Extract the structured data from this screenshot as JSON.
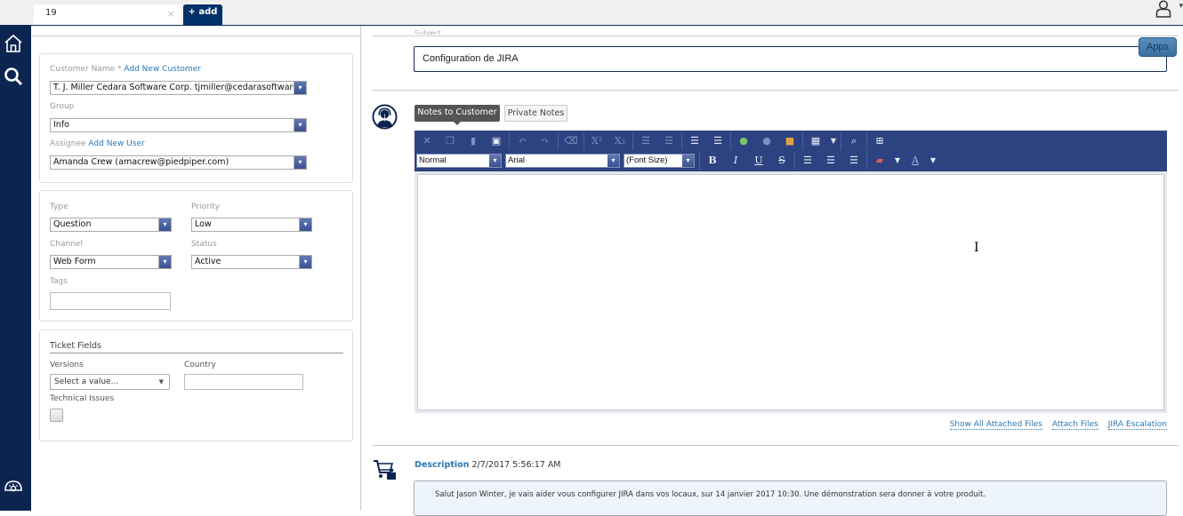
{
  "tabs": {
    "active_tab_label": "19",
    "close_symbol": "×",
    "add_label": "+ add"
  },
  "header": {
    "user_caret": "▾"
  },
  "sidebar": {
    "items": [
      {
        "name": "home",
        "icon": "home-icon"
      },
      {
        "name": "search",
        "icon": "search-icon"
      },
      {
        "name": "support",
        "icon": "support-icon"
      }
    ]
  },
  "customer_card": {
    "customer_label": "Customer Name",
    "required_mark": "*",
    "add_customer_link": "Add New Customer",
    "customer_value": "T. J. Miller Cedara Software Corp. tjmiller@cedarasoftware.com",
    "group_label": "Group",
    "group_value": "Info",
    "assignee_label": "Assignee",
    "add_user_link": "Add New User",
    "assignee_value": "Amanda Crew (amacrew@piedpiper.com)"
  },
  "properties_card": {
    "type_label": "Type",
    "type_value": "Question",
    "priority_label": "Priority",
    "priority_value": "Low",
    "channel_label": "Channel",
    "channel_value": "Web Form",
    "status_label": "Status",
    "status_value": "Active",
    "tags_label": "Tags",
    "tags_value": ""
  },
  "ticket_fields": {
    "title": "Ticket Fields",
    "versions_label": "Versions",
    "versions_placeholder": "Select a value...",
    "country_label": "Country",
    "country_value": "",
    "technical_issues_label": "Technical Issues",
    "technical_issues_checked": false
  },
  "subject": {
    "label": "Subject",
    "value": "Configuration de JIRA"
  },
  "apps_button": "Apps",
  "notes": {
    "tabs": [
      {
        "label": "Notes to Customer",
        "active": true
      },
      {
        "label": "Private Notes",
        "active": false
      }
    ]
  },
  "editor": {
    "toolbar_row1": [
      "cut",
      "copy",
      "paste",
      "paste-from-word",
      "undo",
      "redo",
      "format-stripper",
      "superscript",
      "subscript",
      "ordered-list",
      "unordered-list",
      "indent",
      "outdent",
      "hyperlink",
      "remove-link",
      "image-manager",
      "insert-table",
      "find-replace",
      "toggle-fullscreen"
    ],
    "paragraph_style": "Normal",
    "font_name": "Arial",
    "font_size": "(Font Size)",
    "toolbar_row2": [
      "bold",
      "italic",
      "underline",
      "strikethrough",
      "align-left",
      "align-center",
      "align-right",
      "background-color",
      "fore-color"
    ],
    "bold_glyph": "B",
    "italic_glyph": "I",
    "underline_glyph": "U",
    "strike_glyph": "S",
    "content": ""
  },
  "file_links": {
    "show_all": "Show All Attached Files",
    "attach": "Attach Files",
    "jira": "JIRA Escalation"
  },
  "description": {
    "title": "Description",
    "timestamp": "2/7/2017 5:56:17 AM",
    "text": "Salut Jason Winter, je vais aider vous configurer JIRA dans vos locaux, sur 14 janvier 2017 10:30. Une démonstration sera donner à votre produit."
  }
}
